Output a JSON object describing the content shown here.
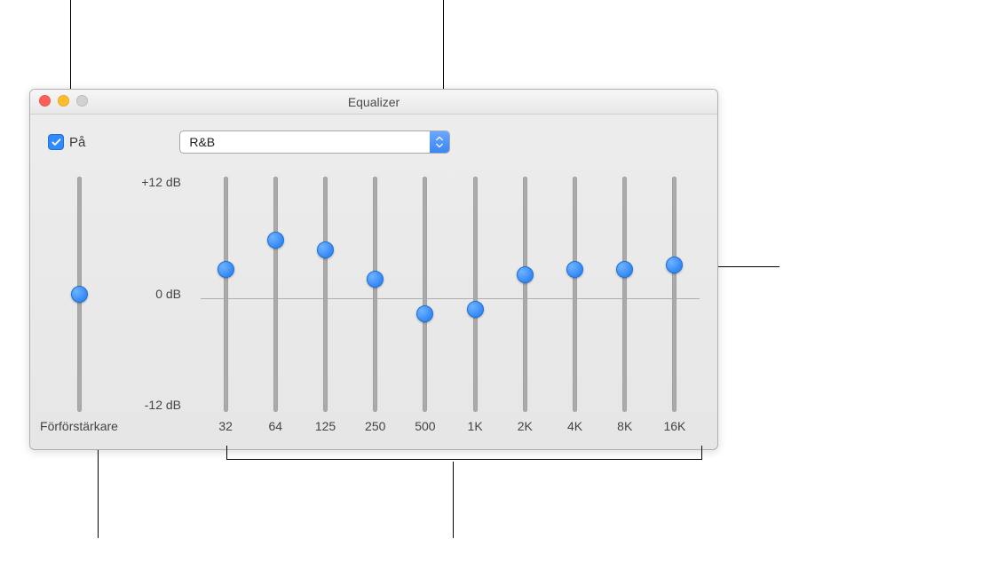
{
  "window": {
    "title": "Equalizer",
    "checkbox_on": true,
    "checkbox_label": "På",
    "preset_value": "R&B",
    "preamp_label": "Förförstärkare",
    "db_labels": {
      "top": "+12 dB",
      "mid": "0 dB",
      "bot": "-12 dB"
    },
    "preamp_value_db": 0,
    "bands": [
      {
        "freq": "32",
        "value_db": 2.5
      },
      {
        "freq": "64",
        "value_db": 5.5
      },
      {
        "freq": "125",
        "value_db": 4.5
      },
      {
        "freq": "250",
        "value_db": 1.5
      },
      {
        "freq": "500",
        "value_db": -2
      },
      {
        "freq": "1K",
        "value_db": -1.5
      },
      {
        "freq": "2K",
        "value_db": 2
      },
      {
        "freq": "4K",
        "value_db": 2.5
      },
      {
        "freq": "8K",
        "value_db": 2.5
      },
      {
        "freq": "16K",
        "value_db": 3
      }
    ]
  },
  "chart_data": {
    "type": "bar",
    "title": "Equalizer",
    "categories": [
      "32",
      "64",
      "125",
      "250",
      "500",
      "1K",
      "2K",
      "4K",
      "8K",
      "16K"
    ],
    "values": [
      2.5,
      5.5,
      4.5,
      1.5,
      -2,
      -1.5,
      2,
      2.5,
      2.5,
      3
    ],
    "ylabel": "dB",
    "ylim": [
      -12,
      12
    ]
  }
}
